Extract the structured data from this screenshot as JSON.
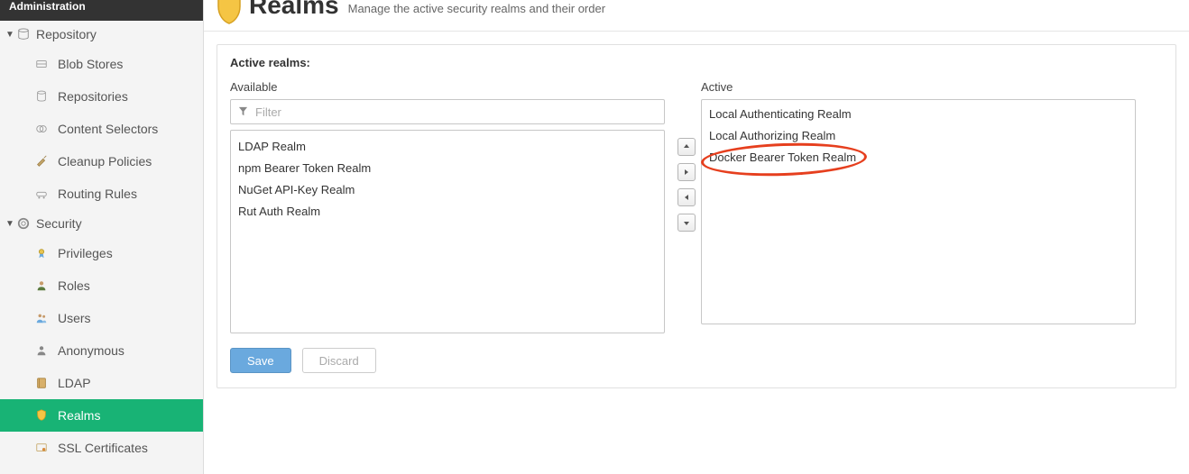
{
  "admin_header": "Administration",
  "sidebar": {
    "groups": [
      {
        "key": "repository",
        "label": "Repository",
        "icon": "database",
        "items": [
          {
            "icon": "blobstore",
            "label": "Blob Stores"
          },
          {
            "icon": "database",
            "label": "Repositories"
          },
          {
            "icon": "venn",
            "label": "Content Selectors"
          },
          {
            "icon": "broom",
            "label": "Cleanup Policies"
          },
          {
            "icon": "route",
            "label": "Routing Rules"
          }
        ]
      },
      {
        "key": "security",
        "label": "Security",
        "icon": "life-ring",
        "items": [
          {
            "icon": "medal",
            "label": "Privileges"
          },
          {
            "icon": "person-role",
            "label": "Roles"
          },
          {
            "icon": "people",
            "label": "Users"
          },
          {
            "icon": "person-anon",
            "label": "Anonymous"
          },
          {
            "icon": "book",
            "label": "LDAP"
          },
          {
            "icon": "shield",
            "label": "Realms",
            "active": true
          },
          {
            "icon": "cert",
            "label": "SSL Certificates"
          }
        ]
      }
    ]
  },
  "page": {
    "title": "Realms",
    "subtitle": "Manage the active security realms and their order",
    "section_label": "Active realms:",
    "available_title": "Available",
    "active_title": "Active",
    "filter_placeholder": "Filter",
    "available_items": [
      "LDAP Realm",
      "npm Bearer Token Realm",
      "NuGet API-Key Realm",
      "Rut Auth Realm"
    ],
    "active_items": [
      "Local Authenticating Realm",
      "Local Authorizing Realm",
      "Docker Bearer Token Realm"
    ],
    "buttons": {
      "save": "Save",
      "discard": "Discard"
    }
  },
  "annotation": {
    "target": "Docker Bearer Token Realm"
  },
  "colors": {
    "accent": "#18b375",
    "primary_btn": "#6aa9de",
    "annot": "#e63f1e"
  }
}
